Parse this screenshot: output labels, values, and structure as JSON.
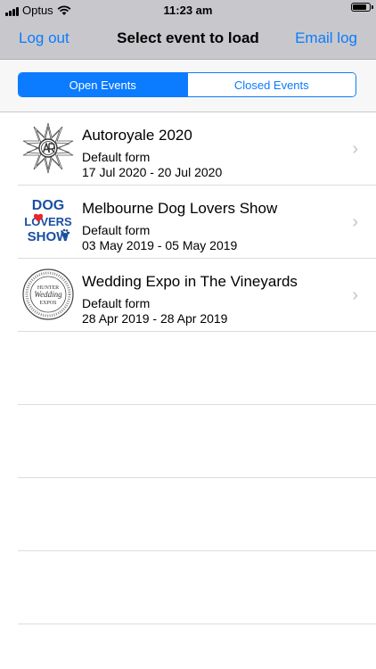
{
  "status": {
    "carrier": "Optus",
    "time": "11:23 am",
    "battery_level": 0.9
  },
  "nav": {
    "left_label": "Log out",
    "title": "Select event to load",
    "right_label": "Email log"
  },
  "segments": {
    "open_label": "Open Events",
    "closed_label": "Closed Events",
    "selected": "open"
  },
  "events": [
    {
      "title": "Autoroyale 2020",
      "form": "Default form",
      "dates": "17 Jul 2020 - 20 Jul 2020",
      "logo_icon": "autoroyale-logo"
    },
    {
      "title": "Melbourne Dog Lovers Show",
      "form": "Default form",
      "dates": "03 May 2019 - 05 May 2019",
      "logo_icon": "dog-lovers-show-logo",
      "logo_text": [
        "DOG",
        "LOVERS",
        "SHOW"
      ]
    },
    {
      "title": "Wedding Expo in The Vineyards",
      "form": "Default form",
      "dates": "28 Apr 2019 - 28 Apr 2019",
      "logo_icon": "hunter-wedding-expo-logo",
      "logo_text": [
        "HUNTER",
        "Wedding",
        "EXPOS"
      ]
    }
  ],
  "colors": {
    "accent": "#0b7bff",
    "bar": "#c8c8cc",
    "separator": "#dcdcdf",
    "dog_logo_blue": "#1a4fa0",
    "heart_red": "#e8262b"
  }
}
